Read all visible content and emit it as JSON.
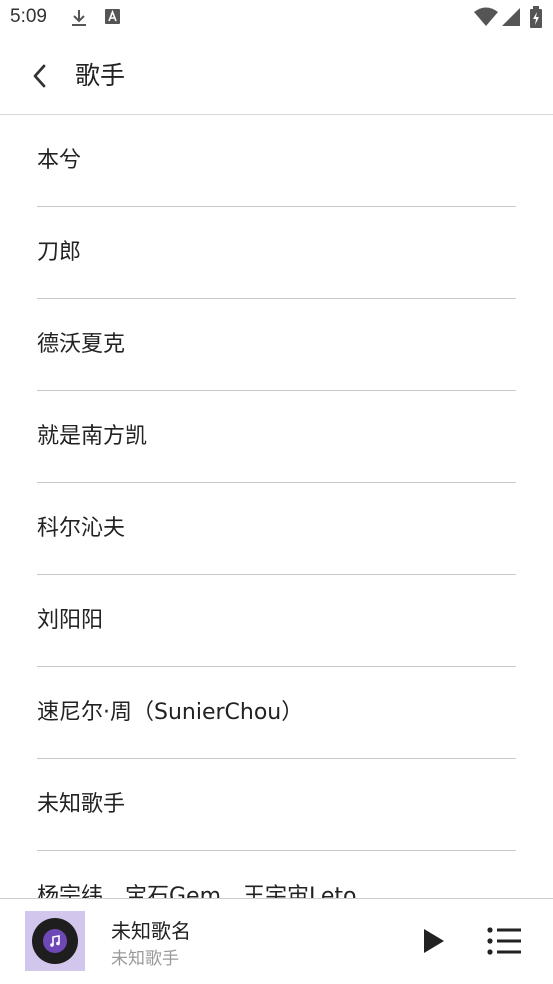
{
  "status_bar": {
    "time": "5:09"
  },
  "header": {
    "title": "歌手"
  },
  "artists": [
    "本兮",
    "刀郎",
    "德沃夏克",
    "就是南方凯",
    "科尔沁夫",
    "刘阳阳",
    "速尼尔·周（SunierChou）",
    "未知歌手",
    "杨宗纬、宝石Gem、王宇宙Leto"
  ],
  "player": {
    "song_title": "未知歌名",
    "artist": "未知歌手"
  },
  "colors": {
    "cover_bg": "#d3c6ec",
    "cover_accent": "#6e48b6"
  }
}
